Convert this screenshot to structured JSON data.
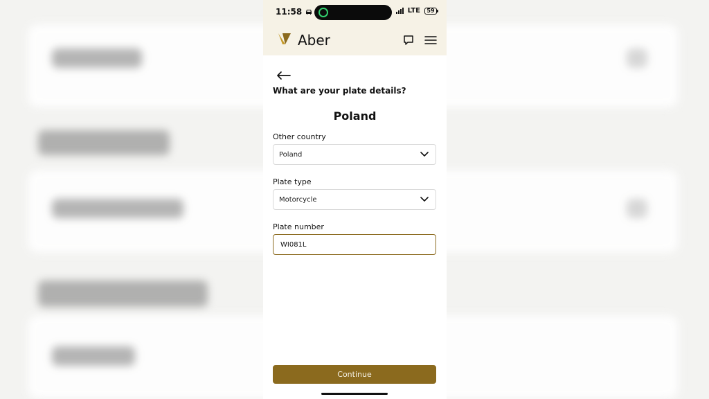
{
  "status_bar": {
    "time": "11:58",
    "network": "LTE",
    "battery": "59"
  },
  "header": {
    "brand": "Aber",
    "icons": {
      "chat": "chat-icon",
      "menu": "menu-icon"
    }
  },
  "form": {
    "question": "What are your plate details?",
    "country_title": "Poland",
    "other_country_label": "Other country",
    "other_country_value": "Poland",
    "plate_type_label": "Plate type",
    "plate_type_value": "Motorcycle",
    "plate_number_label": "Plate number",
    "plate_number_value": "WI081L"
  },
  "actions": {
    "continue_label": "Continue"
  },
  "colors": {
    "accent": "#8b6a1e",
    "header_bg": "#f6f2e6"
  }
}
